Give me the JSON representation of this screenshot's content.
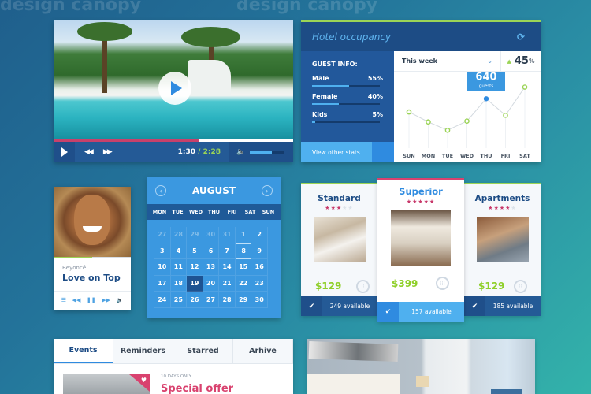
{
  "watermark": "design canopy",
  "video_player": {
    "time_current": "1:30",
    "time_separator": " / ",
    "time_total": "2:28",
    "progress_fraction": 0.61,
    "volume_fraction": 0.65,
    "icons": {
      "play_big": "play-icon",
      "play": "play-icon",
      "rewind": "rewind-icon",
      "forward": "fast-forward-icon",
      "volume": "volume-icon"
    },
    "glyphs": {
      "rewind": "◀◀",
      "forward": "▶▶",
      "volume": "🔈"
    }
  },
  "occupancy": {
    "title": "Hotel occupancy",
    "refresh_glyph": "⟳",
    "guest_info_label": "GUEST INFO:",
    "stats": [
      {
        "label": "Male",
        "value": "55%",
        "fraction": 0.55
      },
      {
        "label": "Female",
        "value": "40%",
        "fraction": 0.4
      },
      {
        "label": "Kids",
        "value": "5%",
        "fraction": 0.05
      }
    ],
    "view_stats_label": "View other stats",
    "period_select": "This week",
    "chevron_glyph": "⌄",
    "change_arrow": "▲",
    "change_value": "45",
    "change_unit": "%",
    "tooltip_value": "640",
    "tooltip_label": "guests",
    "highlight_day": "THU"
  },
  "chart_data": {
    "type": "line",
    "title": "Hotel occupancy",
    "categories": [
      "SUN",
      "MON",
      "TUE",
      "WED",
      "THU",
      "FRI",
      "SAT"
    ],
    "series": [
      {
        "name": "guests",
        "values": [
          560,
          500,
          450,
          505,
          640,
          540,
          710
        ]
      }
    ],
    "ylim": [
      380,
      760
    ],
    "annotations": [
      {
        "x": "THU",
        "text": "640 guests"
      }
    ],
    "grid": false,
    "colors": {
      "line": "#d3d9df",
      "point": "#9bd456",
      "highlight": "#2f8be0"
    }
  },
  "music_player": {
    "artist": "Beyoncé",
    "song": "Love on Top",
    "progress_fraction": 0.5,
    "controls": [
      {
        "name": "playlist-icon",
        "glyph": "☰"
      },
      {
        "name": "previous-icon",
        "glyph": "◀◀"
      },
      {
        "name": "pause-icon",
        "glyph": "❚❚"
      },
      {
        "name": "next-icon",
        "glyph": "▶▶"
      },
      {
        "name": "volume-icon",
        "glyph": "🔈"
      }
    ]
  },
  "calendar": {
    "month": "AUGUST",
    "prev_glyph": "‹",
    "next_glyph": "›",
    "weekdays": [
      "MON",
      "TUE",
      "WED",
      "THU",
      "FRI",
      "SAT",
      "SUN"
    ],
    "days": [
      {
        "d": "27",
        "muted": true
      },
      {
        "d": "28",
        "muted": true
      },
      {
        "d": "29",
        "muted": true
      },
      {
        "d": "30",
        "muted": true
      },
      {
        "d": "31",
        "muted": true
      },
      {
        "d": "1"
      },
      {
        "d": "2"
      },
      {
        "d": "3"
      },
      {
        "d": "4"
      },
      {
        "d": "5"
      },
      {
        "d": "6"
      },
      {
        "d": "7"
      },
      {
        "d": "8",
        "today": true
      },
      {
        "d": "9"
      },
      {
        "d": "10"
      },
      {
        "d": "11"
      },
      {
        "d": "12"
      },
      {
        "d": "13"
      },
      {
        "d": "14"
      },
      {
        "d": "15"
      },
      {
        "d": "16"
      },
      {
        "d": "17"
      },
      {
        "d": "18"
      },
      {
        "d": "19",
        "selected": true
      },
      {
        "d": "20"
      },
      {
        "d": "21"
      },
      {
        "d": "22"
      },
      {
        "d": "23"
      },
      {
        "d": "24"
      },
      {
        "d": "25"
      },
      {
        "d": "26"
      },
      {
        "d": "27"
      },
      {
        "d": "28"
      },
      {
        "d": "29"
      },
      {
        "d": "30"
      }
    ]
  },
  "rooms": [
    {
      "name": "Standard",
      "stars": 3,
      "max_stars": 5,
      "price": "$129",
      "available": "249 available",
      "icon_glyph": "⁞⁞"
    },
    {
      "name": "Superior",
      "stars": 5,
      "max_stars": 5,
      "price": "$399",
      "available": "157 available",
      "icon_glyph": "⁞⁞⁞"
    },
    {
      "name": "Apartments",
      "stars": 4,
      "max_stars": 5,
      "price": "$129",
      "available": "185 available",
      "icon_glyph": "⁞⁞"
    }
  ],
  "check_glyph": "✔",
  "star_glyph": "★",
  "events": {
    "tabs": [
      "Events",
      "Reminders",
      "Starred",
      "Arhive"
    ],
    "active_tab": 0,
    "badge": "10 DAYS ONLY",
    "offer_title": "Special offer",
    "heart_glyph": "♥"
  }
}
